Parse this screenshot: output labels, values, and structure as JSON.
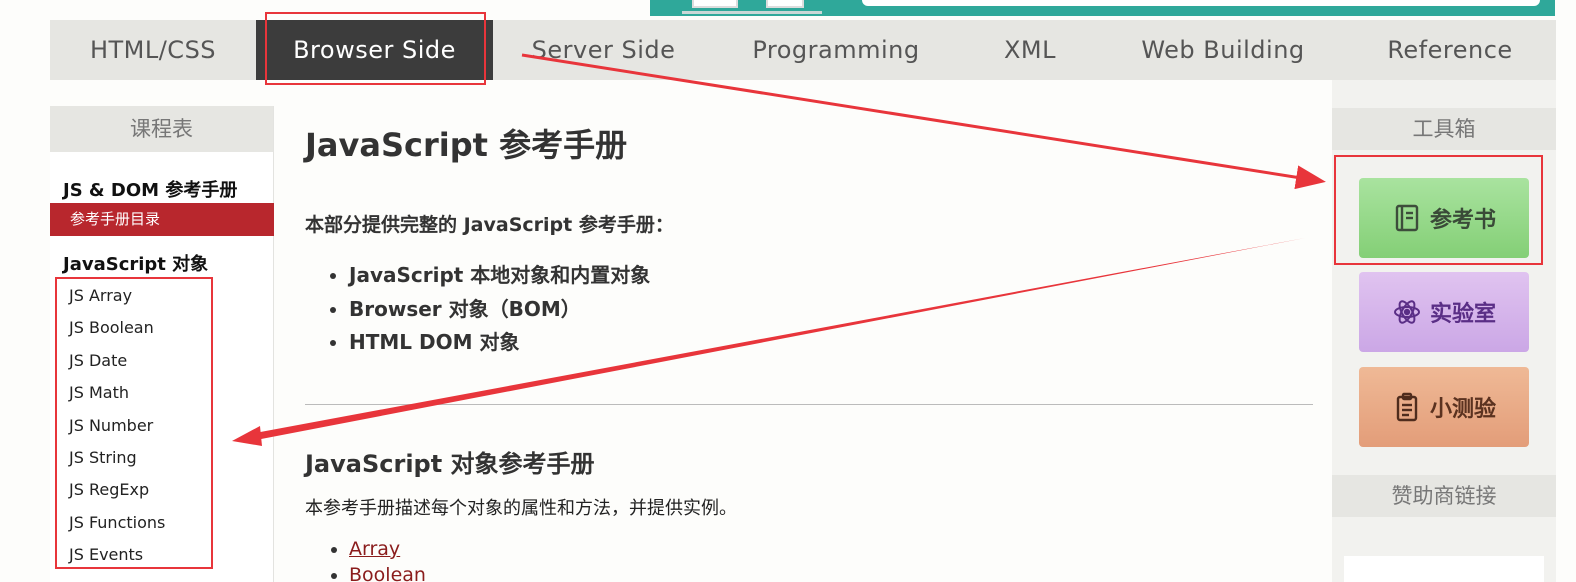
{
  "topnav": {
    "items": [
      {
        "label": "HTML/CSS"
      },
      {
        "label": "Browser Side"
      },
      {
        "label": "Server Side"
      },
      {
        "label": "Programming"
      },
      {
        "label": "XML"
      },
      {
        "label": "Web Building"
      },
      {
        "label": "Reference"
      }
    ],
    "active": "Browser Side"
  },
  "left_sidebar": {
    "header": "课程表",
    "section1_title": "JS & DOM 参考手册",
    "active_link": "参考手册目录",
    "section2_title": "JavaScript 对象",
    "items": [
      {
        "label": "JS Array"
      },
      {
        "label": "JS Boolean"
      },
      {
        "label": "JS Date"
      },
      {
        "label": "JS Math"
      },
      {
        "label": "JS Number"
      },
      {
        "label": "JS String"
      },
      {
        "label": "JS RegExp"
      },
      {
        "label": "JS Functions"
      },
      {
        "label": "JS Events"
      }
    ]
  },
  "main": {
    "title": "JavaScript 参考手册",
    "intro": "本部分提供完整的 JavaScript 参考手册：",
    "bullets": [
      {
        "text": "JavaScript 本地对象和内置对象"
      },
      {
        "text": "Browser 对象（BOM）"
      },
      {
        "text": "HTML DOM 对象"
      }
    ],
    "section_title": "JavaScript 对象参考手册",
    "section_desc": "本参考手册描述每个对象的属性和方法，并提供实例。",
    "links": [
      {
        "label": "Array"
      },
      {
        "label": "Boolean"
      }
    ]
  },
  "right_sidebar": {
    "toolbox_header": "工具箱",
    "buttons": [
      {
        "label": "参考书",
        "icon": "book-icon"
      },
      {
        "label": "实验室",
        "icon": "atom-icon"
      },
      {
        "label": "小测验",
        "icon": "clipboard-icon"
      }
    ],
    "sponsor_header": "赞助商链接"
  },
  "colors": {
    "nav_bg": "#e6e6e2",
    "nav_active_bg": "#3c3c3c",
    "sidebar_active": "#b8272d",
    "banner": "#2fa89a",
    "annotation": "#e8353b",
    "link": "#8a1c1c"
  }
}
